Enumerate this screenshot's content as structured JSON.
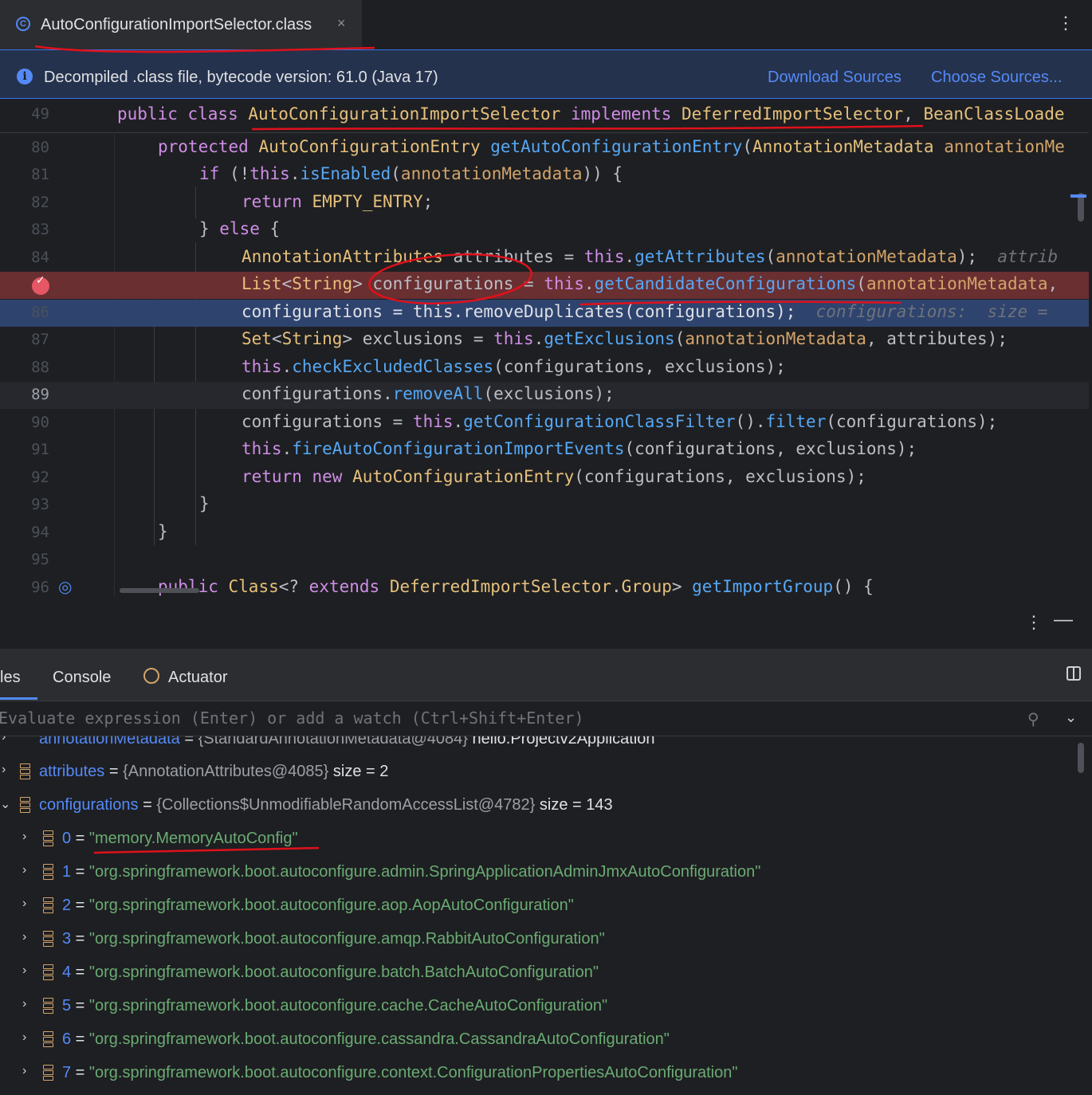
{
  "tab": {
    "title": "AutoConfigurationImportSelector.class",
    "close_glyph": "×",
    "icon": "class-icon"
  },
  "banner": {
    "text": "Decompiled .class file, bytecode version: 61.0 (Java 17)",
    "download_label": "Download Sources",
    "choose_label": "Choose Sources..."
  },
  "editor": {
    "sticky_line_number": "49",
    "lines": [
      {
        "n": "80"
      },
      {
        "n": "81"
      },
      {
        "n": "82"
      },
      {
        "n": "83"
      },
      {
        "n": "84"
      },
      {
        "n": "85"
      },
      {
        "n": "86"
      },
      {
        "n": "87"
      },
      {
        "n": "88"
      },
      {
        "n": "89"
      },
      {
        "n": "90"
      },
      {
        "n": "91"
      },
      {
        "n": "92"
      },
      {
        "n": "93"
      },
      {
        "n": "94"
      },
      {
        "n": "95"
      },
      {
        "n": "96"
      }
    ],
    "inline_hint_84": "attrib",
    "inline_hint_86": "configurations:  size ="
  },
  "debug": {
    "tabs": {
      "variables": "les",
      "console": "Console",
      "actuator": "Actuator"
    },
    "eval_placeholder": "Evaluate expression (Enter) or add a watch (Ctrl+Shift+Enter)",
    "variables": [
      {
        "name": "annotationMetadata",
        "value": "{StandardAnnotationMetadata@4084}",
        "extra": "hello.Projectv2Application"
      },
      {
        "name": "attributes",
        "value": "{AnnotationAttributes@4085}",
        "extra": "size = 2"
      },
      {
        "name": "configurations",
        "value": "{Collections$UnmodifiableRandomAccessList@4782}",
        "extra": "size = 143"
      }
    ],
    "items": [
      {
        "index": "0",
        "value": "\"memory.MemoryAutoConfig\""
      },
      {
        "index": "1",
        "value": "\"org.springframework.boot.autoconfigure.admin.SpringApplicationAdminJmxAutoConfiguration\""
      },
      {
        "index": "2",
        "value": "\"org.springframework.boot.autoconfigure.aop.AopAutoConfiguration\""
      },
      {
        "index": "3",
        "value": "\"org.springframework.boot.autoconfigure.amqp.RabbitAutoConfiguration\""
      },
      {
        "index": "4",
        "value": "\"org.springframework.boot.autoconfigure.batch.BatchAutoConfiguration\""
      },
      {
        "index": "5",
        "value": "\"org.springframework.boot.autoconfigure.cache.CacheAutoConfiguration\""
      },
      {
        "index": "6",
        "value": "\"org.springframework.boot.autoconfigure.cassandra.CassandraAutoConfiguration\""
      },
      {
        "index": "7",
        "value": "\"org.springframework.boot.autoconfigure.context.ConfigurationPropertiesAutoConfiguration\""
      }
    ]
  },
  "colors": {
    "accent": "#548af7",
    "breakpoint": "#e55765",
    "annotation": "#e0111b"
  }
}
